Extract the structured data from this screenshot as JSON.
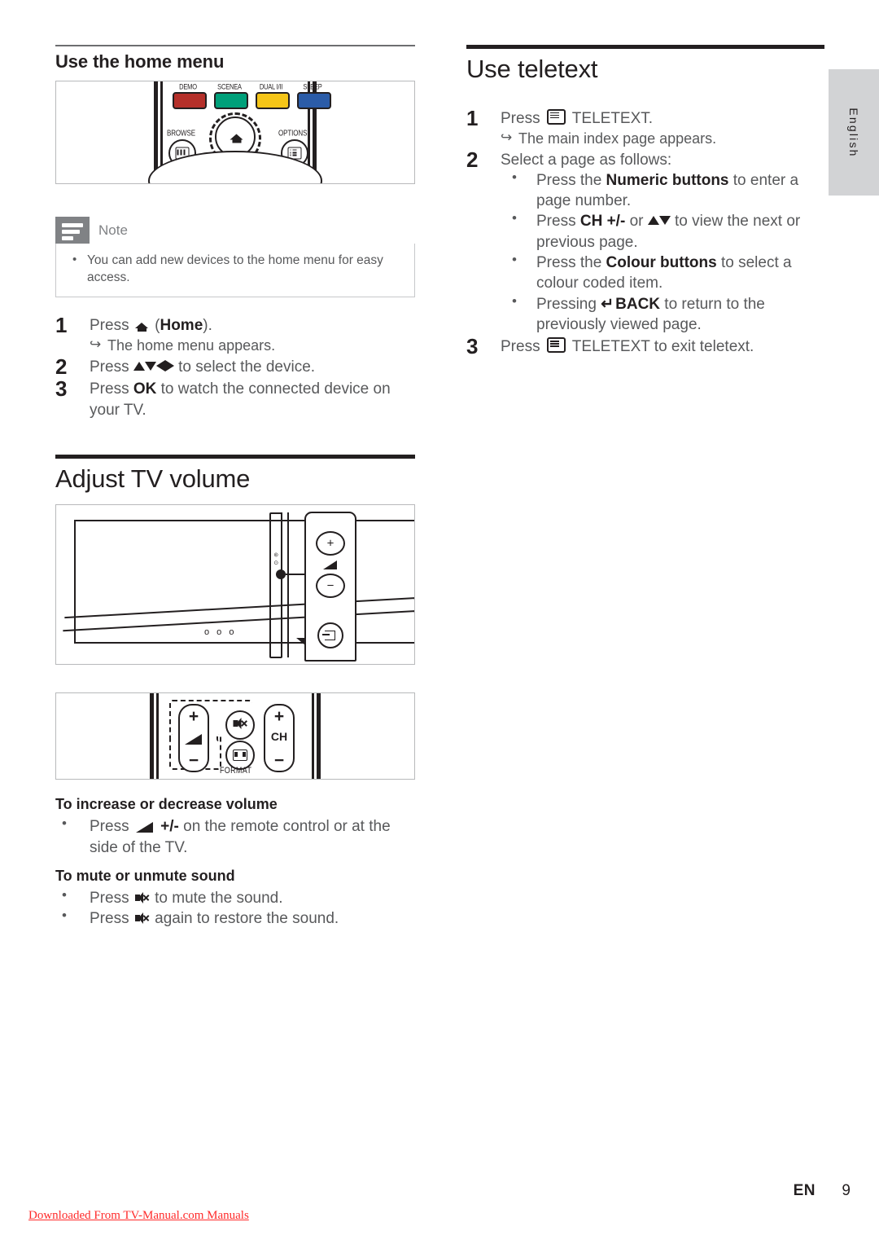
{
  "language_tab": {
    "label": "English"
  },
  "left_column": {
    "home_menu": {
      "heading": "Use the home menu",
      "figure": {
        "name": "remote-top-keys",
        "colour_keys": [
          {
            "label": "DEMO",
            "color": "#b5302a"
          },
          {
            "label": "SCENEA",
            "color": "#00a07a"
          },
          {
            "label": "DUAL I/II",
            "color": "#f5c518"
          },
          {
            "label": "SLEEP",
            "color": "#2b5ca8"
          }
        ],
        "buttons": [
          {
            "label": "BROWSE",
            "icon": "browse-icon"
          },
          {
            "label": "OPTIONS",
            "icon": "options-icon"
          },
          {
            "label": "",
            "icon": "home-icon"
          }
        ]
      },
      "note": {
        "title": "Note",
        "items": [
          "You can add new devices to the home menu for easy access."
        ]
      },
      "steps": [
        {
          "num": "1",
          "text_before": "Press ",
          "icon": "home-icon",
          "text_after_pre": " (",
          "bold": "Home",
          "text_after": ").",
          "result": "The home menu appears."
        },
        {
          "num": "2",
          "text_before": "Press ",
          "arrows": "up-down-left-right-arrows",
          "text_after": " to select the device."
        },
        {
          "num": "3",
          "text_before": "Press ",
          "bold": "OK",
          "text_after": " to watch the connected device on your TV."
        }
      ]
    },
    "tv_volume": {
      "heading": "Adjust TV volume",
      "figure_tv": {
        "name": "tv-side-panel",
        "panel_buttons": [
          "+",
          "volume-wedge",
          "–",
          "source-icon"
        ]
      },
      "figure_remote": {
        "name": "remote-volume-keys",
        "keys": [
          "+",
          "volume-wedge",
          "–",
          "mute-icon",
          "format-icon",
          "CH",
          "+",
          "–"
        ],
        "format_label": "FORMAT",
        "ch_label": "CH"
      },
      "increase_heading": "To increase or decrease volume",
      "increase_bullets": [
        {
          "text_before": "Press ",
          "icon": "volume-icon",
          "bold": " +/-",
          "text_after": " on the remote control or at the side of the TV."
        }
      ],
      "mute_heading": "To mute or unmute sound",
      "mute_bullets": [
        {
          "text_before": "Press ",
          "icon": "mute-icon",
          "text_after": " to mute the sound."
        },
        {
          "text_before": "Press ",
          "icon": "mute-icon",
          "text_after": " again to restore the sound."
        }
      ]
    }
  },
  "right_column": {
    "teletext": {
      "heading": "Use teletext",
      "steps": [
        {
          "num": "1",
          "text_before": "Press ",
          "icon": "teletext-icon",
          "text_after": " TELETEXT.",
          "result": "The main index page appears."
        },
        {
          "num": "2",
          "text_before": "Select a page as follows:",
          "bullets": [
            {
              "text_before": "Press the ",
              "bold": "Numeric buttons",
              "text_after": " to enter a page number."
            },
            {
              "text_before": "Press ",
              "bold": "CH +/-",
              "mid": " or ",
              "arrows": "up-down-arrows",
              "text_after": " to view the next or previous page."
            },
            {
              "text_before": "Press the ",
              "bold": "Colour buttons",
              "text_after": " to select a colour coded item."
            },
            {
              "text_before": "Pressing ",
              "icon": "back-icon",
              "bold": "BACK",
              "text_after": " to return to the previously viewed page."
            }
          ]
        },
        {
          "num": "3",
          "text_before": "Press ",
          "icon": "teletext-icon",
          "text_after": " TELETEXT to exit teletext."
        }
      ]
    }
  },
  "footer": {
    "language_code": "EN",
    "page_number": "9",
    "watermark": "Downloaded From TV-Manual.com Manuals"
  }
}
